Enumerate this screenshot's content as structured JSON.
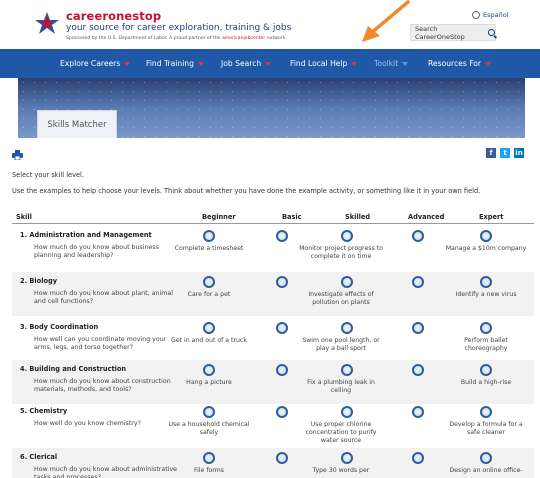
{
  "header": {
    "brand": "careeronestop",
    "tagline": "your source for career exploration, training & jobs",
    "sponsor_prefix": "Sponsored by the U.S. Department of Labor. A proud partner of the",
    "sponsor_partner": "americanjobcenter",
    "sponsor_suffix": "network.",
    "espanol": "Español",
    "search_label": "Search CareerOneStop",
    "accent_color": "#c8102e",
    "brand_blue": "#1f3c88"
  },
  "nav": {
    "items": [
      {
        "label": "Explore Careers"
      },
      {
        "label": "Find Training"
      },
      {
        "label": "Job Search"
      },
      {
        "label": "Find Local Help"
      },
      {
        "label": "Toolkit"
      },
      {
        "label": "Resources For"
      }
    ],
    "background": "#1f58a6"
  },
  "banner": {
    "tab_label": "Skills Matcher"
  },
  "social": {
    "facebook": "f",
    "twitter": "t",
    "linkedin": "in"
  },
  "intro": {
    "line1": "Select your skill level.",
    "line2": "Use the examples to help choose your levels. Think about whether you have done the example activity, or something like it in your own field."
  },
  "table": {
    "headers": [
      "Skill",
      "Beginner",
      "Basic",
      "Skilled",
      "Advanced",
      "Expert"
    ],
    "rows": [
      {
        "name": "1. Administration and Management",
        "question": "How much do you know about business planning and leadership?",
        "beginner": "Complete a timesheet",
        "skilled": "Monitor project progress to complete it on time",
        "expert": "Manage a $10m company"
      },
      {
        "name": "2. Biology",
        "question": "How much do you know about plant, animal and cell functions?",
        "beginner": "Care for a pet",
        "skilled": "Investigate effects of pollution on plants",
        "expert": "Identify a new virus"
      },
      {
        "name": "3. Body Coordination",
        "question": "How well can you coordinate moving your arms, legs, and torso together?",
        "beginner": "Get in and out of a truck",
        "skilled": "Swim one pool length, or play a ball sport",
        "expert": "Perform ballet choreography"
      },
      {
        "name": "4. Building and Construction",
        "question": "How much do you know about construction materials, methods, and tools?",
        "beginner": "Hang a picture",
        "skilled": "Fix a plumbing leak in ceiling",
        "expert": "Build a high-rise"
      },
      {
        "name": "5. Chemistry",
        "question": "How well do you know chemistry?",
        "beginner": "Use a household chemical safely",
        "skilled": "Use proper chlorine concentration to purify water source",
        "expert": "Develop a formula for a safe cleaner"
      },
      {
        "name": "6. Clerical",
        "question": "How much do you know about administrative tasks and processes?",
        "beginner": "File forms",
        "skilled": "Type 30 words per",
        "expert": "Design an online office-"
      }
    ]
  }
}
